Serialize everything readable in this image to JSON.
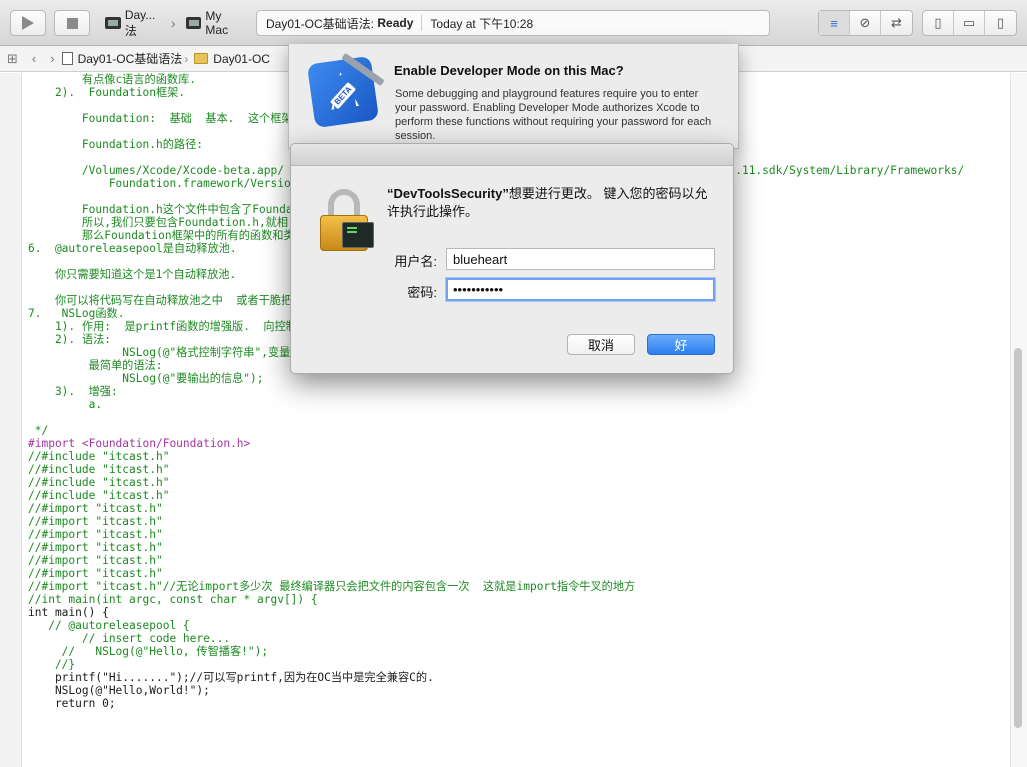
{
  "toolbar": {
    "scheme": "Day...法",
    "destination": "My Mac",
    "status_project": "Day01-OC基础语法:",
    "status_state": "Ready",
    "status_time": "Today at 下午10:28"
  },
  "jumpbar": {
    "file": "Day01-OC基础语法",
    "folder": "Day01-OC"
  },
  "code": {
    "lines": [
      {
        "cls": "c-green",
        "text": "        有点像c语言的函数库."
      },
      {
        "cls": "c-green",
        "text": "    2).  Foundation框架."
      },
      {
        "cls": "c-green",
        "text": ""
      },
      {
        "cls": "c-green",
        "text": "        Foundation:  基础  基本.  这个框架"
      },
      {
        "cls": "c-green",
        "text": ""
      },
      {
        "cls": "c-green",
        "text": "        Foundation.h的路径:"
      },
      {
        "cls": "c-green",
        "text": ""
      },
      {
        "cls": "c-green",
        "text": "        /Volumes/Xcode/Xcode-beta.app/                                                                   .11.sdk/System/Library/Frameworks/"
      },
      {
        "cls": "c-green",
        "text": "            Foundation.framework/Versio"
      },
      {
        "cls": "c-green",
        "text": ""
      },
      {
        "cls": "c-green",
        "text": "        Foundation.h这个文件中包含了Foundati"
      },
      {
        "cls": "c-green",
        "text": "        所以,我们只要包含Foundation.h,就相"
      },
      {
        "cls": "c-green",
        "text": "        那么Foundation框架中的所有的函数和类"
      },
      {
        "cls": "c-green",
        "text": "6.  @autoreleasepool是自动释放池."
      },
      {
        "cls": "c-green",
        "text": ""
      },
      {
        "cls": "c-green",
        "text": "    你只需要知道这个是1个自动释放池."
      },
      {
        "cls": "c-green",
        "text": ""
      },
      {
        "cls": "c-green",
        "text": "    你可以将代码写在自动释放池之中  或者干脆把这"
      },
      {
        "cls": "c-green",
        "text": "7.   NSLog函数."
      },
      {
        "cls": "c-green",
        "text": "    1). 作用:  是printf函数的增强版.  向控制"
      },
      {
        "cls": "c-green",
        "text": "    2). 语法:"
      },
      {
        "cls": "c-green",
        "text": "              NSLog(@\"格式控制字符串\",变量列表);"
      },
      {
        "cls": "c-green",
        "text": "         最简单的语法:"
      },
      {
        "cls": "c-green",
        "text": "              NSLog(@\"要输出的信息\");"
      },
      {
        "cls": "c-green",
        "text": "    3).  增强:"
      },
      {
        "cls": "c-green",
        "text": "         a."
      },
      {
        "cls": "c-green",
        "text": ""
      },
      {
        "cls": "c-green",
        "text": " */"
      },
      {
        "cls": "c-purple",
        "text": "#import <Foundation/Foundation.h>"
      },
      {
        "cls": "c-green",
        "text": "//#include \"itcast.h\""
      },
      {
        "cls": "c-green",
        "text": "//#include \"itcast.h\""
      },
      {
        "cls": "c-green",
        "text": "//#include \"itcast.h\""
      },
      {
        "cls": "c-green",
        "text": "//#include \"itcast.h\""
      },
      {
        "cls": "c-green",
        "text": "//#import \"itcast.h\""
      },
      {
        "cls": "c-green",
        "text": "//#import \"itcast.h\""
      },
      {
        "cls": "c-green",
        "text": "//#import \"itcast.h\""
      },
      {
        "cls": "c-green",
        "text": "//#import \"itcast.h\""
      },
      {
        "cls": "c-green",
        "text": "//#import \"itcast.h\""
      },
      {
        "cls": "c-green",
        "text": "//#import \"itcast.h\""
      },
      {
        "cls": "c-green",
        "text": "//#import \"itcast.h\"//无论import多少次 最终编译器只会把文件的内容包含一次  这就是import指令牛叉的地方"
      },
      {
        "cls": "c-green",
        "text": "//int main(int argc, const char * argv[]) {"
      },
      {
        "cls": "c-dark",
        "text": "int main() {"
      },
      {
        "cls": "c-green",
        "text": "   // @autoreleasepool {"
      },
      {
        "cls": "c-green",
        "text": "        // insert code here..."
      },
      {
        "cls": "c-green",
        "text": "     //   NSLog(@\"Hello, 传智播客!\");"
      },
      {
        "cls": "c-green",
        "text": "    //}"
      },
      {
        "cls": "c-dark",
        "text": "    printf(\"Hi.......\");//可以写printf,因为在OC当中是完全兼容C的."
      },
      {
        "cls": "c-dark",
        "text": "    NSLog(@\"Hello,World!\");"
      },
      {
        "cls": "c-dark",
        "text": "    return 0;"
      }
    ]
  },
  "dev_sheet": {
    "badge": "BETA",
    "title": "Enable Developer Mode on this Mac?",
    "body": "Some debugging and playground features require you to enter your password. Enabling Developer Mode authorizes Xcode to perform these functions without requiring your password for each session."
  },
  "auth_dialog": {
    "message_name": "“DevToolsSecurity”",
    "message_rest": "想要进行更改。 键入您的密码以允许执行此操作。",
    "username_label": "用户名:",
    "username_value": "blueheart",
    "password_label": "密码:",
    "password_value": "•••••••••••",
    "cancel_label": "取消",
    "ok_label": "好"
  },
  "colors": {
    "accent": "#2c7df0",
    "comment_green": "#1d8a22"
  }
}
